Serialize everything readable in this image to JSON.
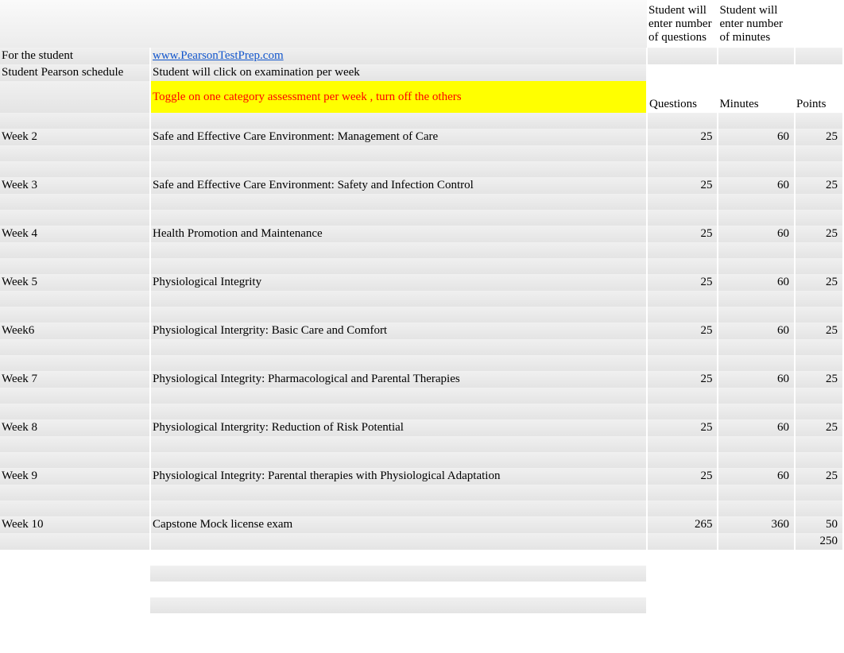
{
  "header": {
    "col_c": "Student will enter number of questions",
    "col_d": "Student will enter number of minutes"
  },
  "intro": {
    "for_student_label": "For the student",
    "url": "www.PearsonTestPrep.com",
    "schedule_label": "Student Pearson schedule",
    "schedule_desc": "Student will click on examination per week",
    "toggle_note": "Toggle on one category assessment per week , turn off the others",
    "questions_label": "Questions",
    "minutes_label": "Minutes",
    "points_label": "Points"
  },
  "weeks": [
    {
      "week": "Week 2",
      "topic": "Safe and Effective Care Environment: Management of Care",
      "questions": "25",
      "minutes": "60",
      "points": "25"
    },
    {
      "week": "Week 3",
      "topic": "Safe and Effective Care Environment: Safety and Infection Control",
      "questions": "25",
      "minutes": "60",
      "points": "25"
    },
    {
      "week": "Week 4",
      "topic": "Health Promotion and Maintenance",
      "questions": "25",
      "minutes": "60",
      "points": "25"
    },
    {
      "week": "Week 5",
      "topic": "Physiological Integrity",
      "questions": "25",
      "minutes": "60",
      "points": "25"
    },
    {
      "week": "Week6",
      "topic": "Physiological Intergrity: Basic Care and Comfort",
      "questions": "25",
      "minutes": "60",
      "points": "25"
    },
    {
      "week": "Week 7",
      "topic": "Physiological Integrity: Pharmacological and Parental Therapies",
      "questions": "25",
      "minutes": "60",
      "points": "25"
    },
    {
      "week": "Week 8",
      "topic": "Physiological Intergrity: Reduction of Risk Potential",
      "questions": "25",
      "minutes": "60",
      "points": "25"
    },
    {
      "week": "Week 9",
      "topic": "Physiological Integrity: Parental therapies with Physiological Adaptation",
      "questions": "25",
      "minutes": "60",
      "points": "25"
    },
    {
      "week": "Week 10",
      "topic": "Capstone Mock license exam",
      "questions": "265",
      "minutes": "360",
      "points": "50"
    }
  ],
  "total_points": "250"
}
